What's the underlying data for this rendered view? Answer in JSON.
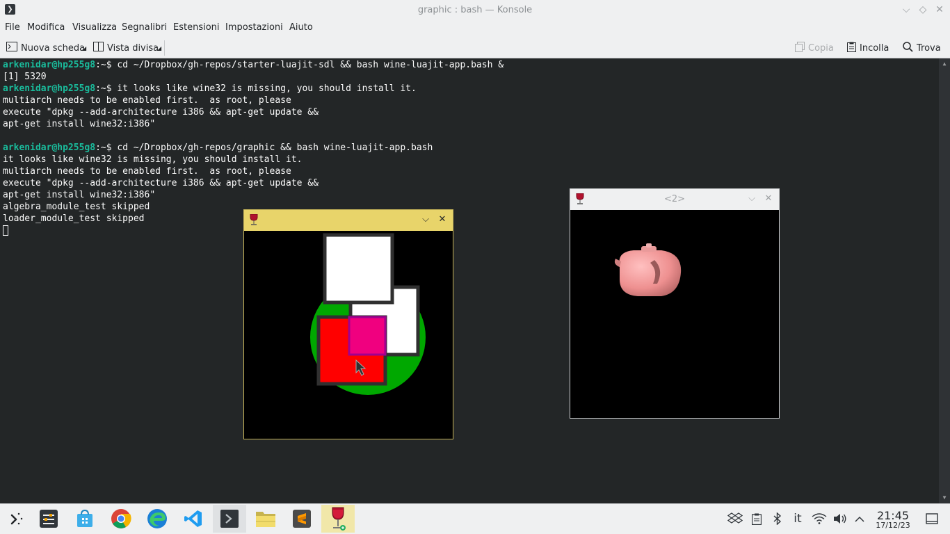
{
  "window": {
    "title": "graphic : bash — Konsole",
    "app_icon_glyph": "❯",
    "btn_minimize": "⌵",
    "btn_maximize": "◇",
    "btn_close": "✕"
  },
  "menu": [
    "File",
    "Modifica",
    "Visualizza",
    "Segnalibri",
    "Estensioni",
    "Impostazioni",
    "Aiuto"
  ],
  "toolbar": {
    "new_tab": "Nuova scheda",
    "split_view": "Vista divisa",
    "copy": "Copia",
    "paste": "Incolla",
    "find": "Trova"
  },
  "terminal": {
    "lines": [
      {
        "user": "arkenidar@hp255g8",
        "path": ":~$",
        "text": " cd ~/Dropbox/gh-repos/starter-luajit-sdl && bash wine-luajit-app.bash &"
      },
      {
        "text": "[1] 5320"
      },
      {
        "user": "arkenidar@hp255g8",
        "path": ":~$",
        "text": " it looks like wine32 is missing, you should install it."
      },
      {
        "text": "multiarch needs to be enabled first.  as root, please"
      },
      {
        "text": "execute \"dpkg --add-architecture i386 && apt-get update &&"
      },
      {
        "text": "apt-get install wine32:i386\""
      },
      {
        "text": ""
      },
      {
        "user": "arkenidar@hp255g8",
        "path": ":~$",
        "text": " cd ~/Dropbox/gh-repos/graphic && bash wine-luajit-app.bash"
      },
      {
        "text": "it looks like wine32 is missing, you should install it."
      },
      {
        "text": "multiarch needs to be enabled first.  as root, please"
      },
      {
        "text": "execute \"dpkg --add-architecture i386 && apt-get update &&"
      },
      {
        "text": "apt-get install wine32:i386\""
      },
      {
        "text": "algebra_module_test skipped"
      },
      {
        "text": "loader_module_test skipped"
      }
    ]
  },
  "wine_window_1": {
    "title": "",
    "icon": "wine-glass-icon",
    "btn_minimize": "⌵",
    "btn_close": "✕",
    "bar_color": "#e8d46a"
  },
  "wine_window_2": {
    "title": "<2>",
    "icon": "wine-glass-icon",
    "btn_minimize": "⌵",
    "btn_close": "✕",
    "bar_color": "#eff0f1"
  },
  "colors": {
    "accent_green": "#1abc9c",
    "terminal_bg": "#232627",
    "shape_green": "#00a800",
    "shape_red": "#ff0000",
    "shape_magenta": "#f0007f",
    "teapot": "#f29a9a"
  },
  "taskbar": {
    "apps": [
      "app-launcher-icon",
      "system-settings-icon",
      "discover-store-icon",
      "chrome-icon",
      "edge-icon",
      "vscode-icon",
      "konsole-icon",
      "file-manager-icon",
      "sublime-text-icon",
      "wine-icon"
    ],
    "tray": [
      "dropbox-icon",
      "clipboard-icon",
      "bluetooth-icon",
      "keyboard-layout",
      "wifi-icon",
      "volume-icon",
      "tray-expand-icon"
    ],
    "keyboard_layout": "it",
    "clock_time": "21:45",
    "clock_date": "17/12/23"
  }
}
